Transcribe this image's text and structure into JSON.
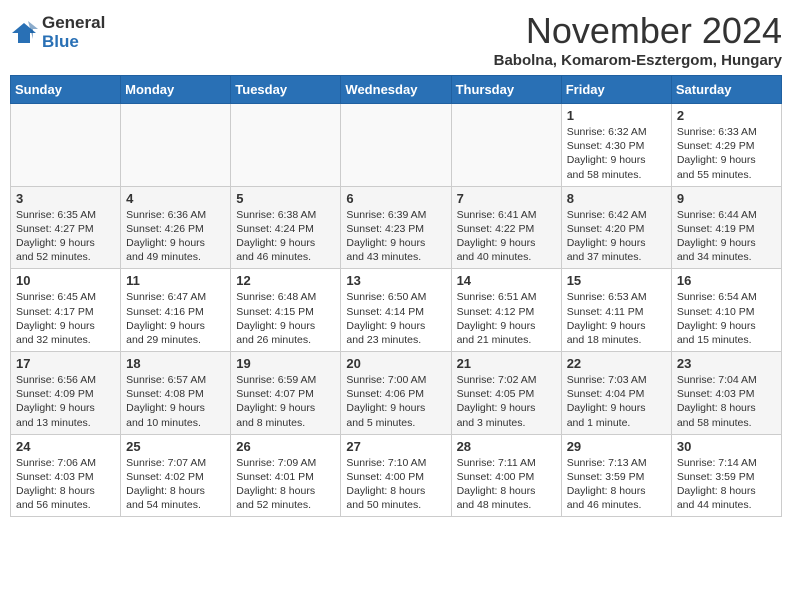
{
  "header": {
    "logo_line1": "General",
    "logo_line2": "Blue",
    "month": "November 2024",
    "location": "Babolna, Komarom-Esztergom, Hungary"
  },
  "weekdays": [
    "Sunday",
    "Monday",
    "Tuesday",
    "Wednesday",
    "Thursday",
    "Friday",
    "Saturday"
  ],
  "weeks": [
    [
      {
        "day": "",
        "info": ""
      },
      {
        "day": "",
        "info": ""
      },
      {
        "day": "",
        "info": ""
      },
      {
        "day": "",
        "info": ""
      },
      {
        "day": "",
        "info": ""
      },
      {
        "day": "1",
        "info": "Sunrise: 6:32 AM\nSunset: 4:30 PM\nDaylight: 9 hours and 58 minutes."
      },
      {
        "day": "2",
        "info": "Sunrise: 6:33 AM\nSunset: 4:29 PM\nDaylight: 9 hours and 55 minutes."
      }
    ],
    [
      {
        "day": "3",
        "info": "Sunrise: 6:35 AM\nSunset: 4:27 PM\nDaylight: 9 hours and 52 minutes."
      },
      {
        "day": "4",
        "info": "Sunrise: 6:36 AM\nSunset: 4:26 PM\nDaylight: 9 hours and 49 minutes."
      },
      {
        "day": "5",
        "info": "Sunrise: 6:38 AM\nSunset: 4:24 PM\nDaylight: 9 hours and 46 minutes."
      },
      {
        "day": "6",
        "info": "Sunrise: 6:39 AM\nSunset: 4:23 PM\nDaylight: 9 hours and 43 minutes."
      },
      {
        "day": "7",
        "info": "Sunrise: 6:41 AM\nSunset: 4:22 PM\nDaylight: 9 hours and 40 minutes."
      },
      {
        "day": "8",
        "info": "Sunrise: 6:42 AM\nSunset: 4:20 PM\nDaylight: 9 hours and 37 minutes."
      },
      {
        "day": "9",
        "info": "Sunrise: 6:44 AM\nSunset: 4:19 PM\nDaylight: 9 hours and 34 minutes."
      }
    ],
    [
      {
        "day": "10",
        "info": "Sunrise: 6:45 AM\nSunset: 4:17 PM\nDaylight: 9 hours and 32 minutes."
      },
      {
        "day": "11",
        "info": "Sunrise: 6:47 AM\nSunset: 4:16 PM\nDaylight: 9 hours and 29 minutes."
      },
      {
        "day": "12",
        "info": "Sunrise: 6:48 AM\nSunset: 4:15 PM\nDaylight: 9 hours and 26 minutes."
      },
      {
        "day": "13",
        "info": "Sunrise: 6:50 AM\nSunset: 4:14 PM\nDaylight: 9 hours and 23 minutes."
      },
      {
        "day": "14",
        "info": "Sunrise: 6:51 AM\nSunset: 4:12 PM\nDaylight: 9 hours and 21 minutes."
      },
      {
        "day": "15",
        "info": "Sunrise: 6:53 AM\nSunset: 4:11 PM\nDaylight: 9 hours and 18 minutes."
      },
      {
        "day": "16",
        "info": "Sunrise: 6:54 AM\nSunset: 4:10 PM\nDaylight: 9 hours and 15 minutes."
      }
    ],
    [
      {
        "day": "17",
        "info": "Sunrise: 6:56 AM\nSunset: 4:09 PM\nDaylight: 9 hours and 13 minutes."
      },
      {
        "day": "18",
        "info": "Sunrise: 6:57 AM\nSunset: 4:08 PM\nDaylight: 9 hours and 10 minutes."
      },
      {
        "day": "19",
        "info": "Sunrise: 6:59 AM\nSunset: 4:07 PM\nDaylight: 9 hours and 8 minutes."
      },
      {
        "day": "20",
        "info": "Sunrise: 7:00 AM\nSunset: 4:06 PM\nDaylight: 9 hours and 5 minutes."
      },
      {
        "day": "21",
        "info": "Sunrise: 7:02 AM\nSunset: 4:05 PM\nDaylight: 9 hours and 3 minutes."
      },
      {
        "day": "22",
        "info": "Sunrise: 7:03 AM\nSunset: 4:04 PM\nDaylight: 9 hours and 1 minute."
      },
      {
        "day": "23",
        "info": "Sunrise: 7:04 AM\nSunset: 4:03 PM\nDaylight: 8 hours and 58 minutes."
      }
    ],
    [
      {
        "day": "24",
        "info": "Sunrise: 7:06 AM\nSunset: 4:03 PM\nDaylight: 8 hours and 56 minutes."
      },
      {
        "day": "25",
        "info": "Sunrise: 7:07 AM\nSunset: 4:02 PM\nDaylight: 8 hours and 54 minutes."
      },
      {
        "day": "26",
        "info": "Sunrise: 7:09 AM\nSunset: 4:01 PM\nDaylight: 8 hours and 52 minutes."
      },
      {
        "day": "27",
        "info": "Sunrise: 7:10 AM\nSunset: 4:00 PM\nDaylight: 8 hours and 50 minutes."
      },
      {
        "day": "28",
        "info": "Sunrise: 7:11 AM\nSunset: 4:00 PM\nDaylight: 8 hours and 48 minutes."
      },
      {
        "day": "29",
        "info": "Sunrise: 7:13 AM\nSunset: 3:59 PM\nDaylight: 8 hours and 46 minutes."
      },
      {
        "day": "30",
        "info": "Sunrise: 7:14 AM\nSunset: 3:59 PM\nDaylight: 8 hours and 44 minutes."
      }
    ]
  ]
}
